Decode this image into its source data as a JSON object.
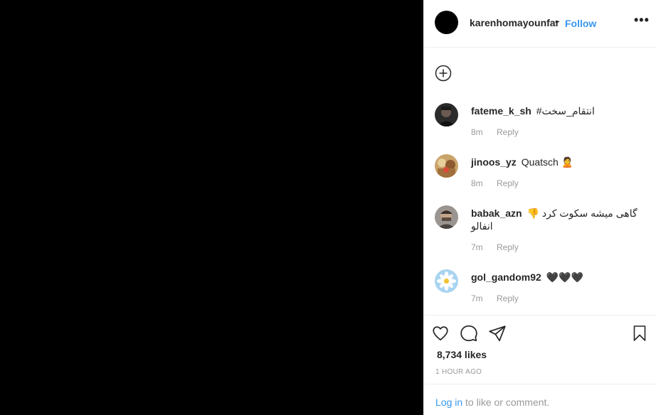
{
  "header": {
    "username": "karenhomayounfar",
    "separator": "•",
    "follow_label": "Follow",
    "more_label": "•••"
  },
  "comments": [
    {
      "username": "fateme_k_sh",
      "text": "#انتقام_سخت",
      "time": "8m",
      "reply_label": "Reply"
    },
    {
      "username": "jinoos_yz",
      "text": "Quatsch 🙎",
      "time": "8m",
      "reply_label": "Reply"
    },
    {
      "username": "babak_azn",
      "text": "👎 گاهی میشه سکوت کرد انفالو",
      "time": "7m",
      "reply_label": "Reply"
    },
    {
      "username": "gol_gandom92",
      "text": "🖤🖤🖤",
      "time": "7m",
      "reply_label": "Reply"
    }
  ],
  "actions": {
    "likes": "8,734 likes",
    "time_ago": "1 HOUR AGO"
  },
  "login": {
    "link_label": "Log in",
    "rest_text": " to like or comment."
  },
  "icons": {
    "add": "plus-circle-icon",
    "like": "heart-icon",
    "comment": "comment-bubble-icon",
    "share": "paper-plane-icon",
    "save": "bookmark-icon"
  }
}
